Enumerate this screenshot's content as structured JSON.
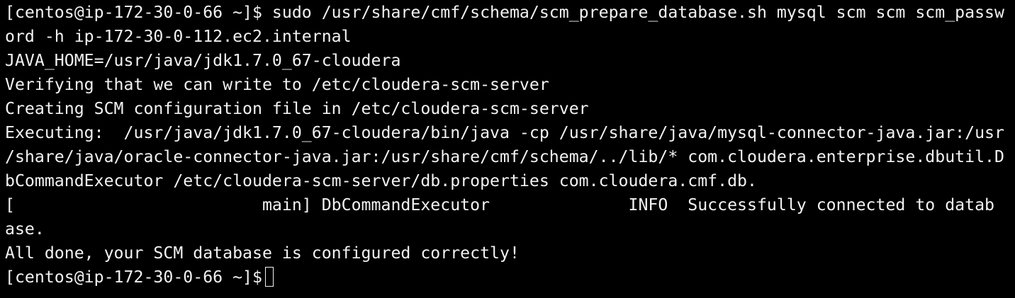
{
  "terminal": {
    "lines": [
      "[centos@ip-172-30-0-66 ~]$ sudo /usr/share/cmf/schema/scm_prepare_database.sh mysql scm scm scm_passw",
      "ord -h ip-172-30-0-112.ec2.internal",
      "JAVA_HOME=/usr/java/jdk1.7.0_67-cloudera",
      "Verifying that we can write to /etc/cloudera-scm-server",
      "Creating SCM configuration file in /etc/cloudera-scm-server",
      "Executing:  /usr/java/jdk1.7.0_67-cloudera/bin/java -cp /usr/share/java/mysql-connector-java.jar:/usr",
      "/share/java/oracle-connector-java.jar:/usr/share/cmf/schema/../lib/* com.cloudera.enterprise.dbutil.D",
      "bCommandExecutor /etc/cloudera-scm-server/db.properties com.cloudera.cmf.db.",
      "[                         main] DbCommandExecutor              INFO  Successfully connected to datab",
      "ase.",
      "All done, your SCM database is configured correctly!"
    ],
    "prompt": "[centos@ip-172-30-0-66 ~]$"
  },
  "colors": {
    "background": "#000000",
    "foreground": "#f2f2f2"
  },
  "icons": {
    "cursor": "block-cursor-outline"
  }
}
